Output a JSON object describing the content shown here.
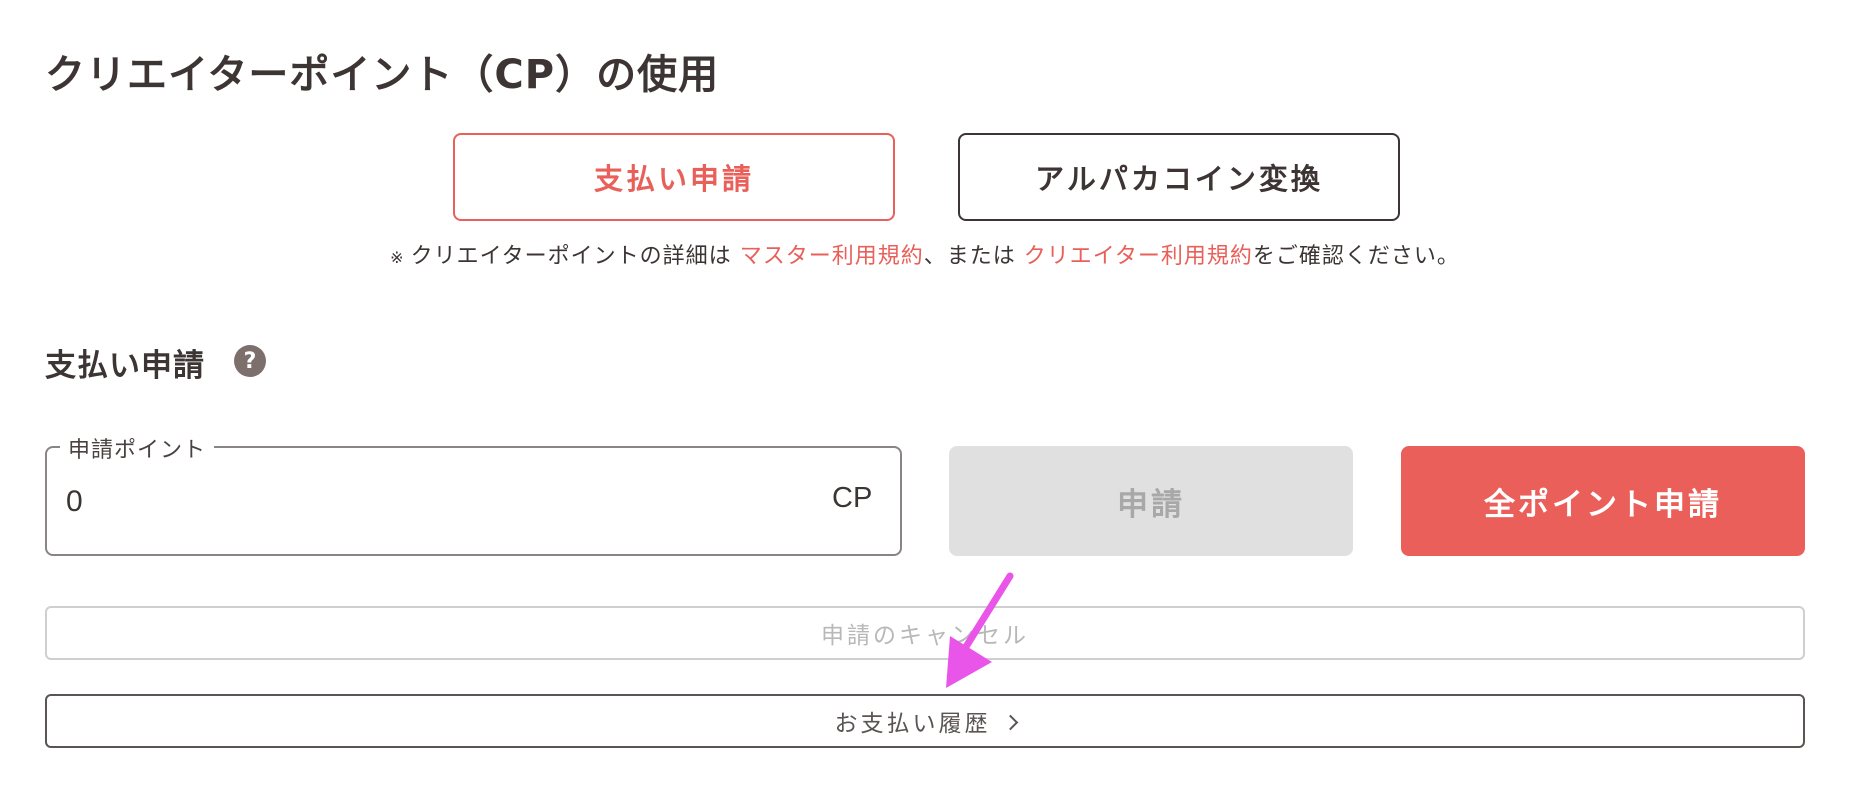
{
  "page_title": "クリエイターポイント（CP）の使用",
  "tabs": [
    {
      "label": "支払い申請",
      "active": true
    },
    {
      "label": "アルパカコイン変換",
      "active": false
    }
  ],
  "note": {
    "mark": "※",
    "prefix": "クリエイターポイントの詳細は ",
    "link1": "マスター利用規約",
    "middle": "、または ",
    "link2": "クリエイター利用規約",
    "suffix": "をご確認ください。"
  },
  "section": {
    "title": "支払い申請",
    "help_icon": "?"
  },
  "points_field": {
    "label": "申請ポイント",
    "value": "0",
    "unit": "CP"
  },
  "buttons": {
    "apply": "申請",
    "apply_all": "全ポイント申請",
    "cancel": "申請のキャンセル",
    "history": "お支払い履歴"
  },
  "colors": {
    "accent": "#e9605a",
    "text": "#3c3533",
    "disabled_bg": "#e0e0e0",
    "annotation_arrow": "#e855e8"
  },
  "icons": {
    "help": "question-circle-icon",
    "history_chevron": "chevron-right-icon",
    "annotation": "arrow-annotation-icon"
  }
}
